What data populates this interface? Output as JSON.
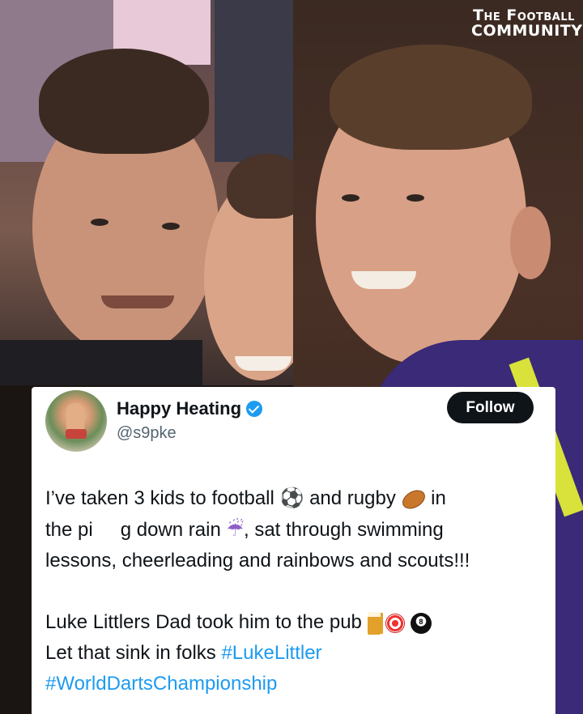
{
  "logo": {
    "line1": "The Football",
    "line2": "Community"
  },
  "tweet": {
    "display_name": "Happy Heating",
    "verified": true,
    "handle": "@s9pke",
    "follow_label": "Follow",
    "line1_a": "I’ve taken 3 kids to football",
    "line1_b": "and rugby",
    "line1_c": "in",
    "line2_a": "the pi",
    "line2_b": "g down rain",
    "line2_c": ", sat through swimming",
    "line3": "lessons, cheerleading and rainbows and scouts!!!",
    "line4": "Luke Littlers Dad took him to the pub",
    "line5": "Let that sink in folks",
    "hashtag1": "#LukeLittler",
    "hashtag2": "#WorldDartsChampionship",
    "eight_ball_number": "8"
  },
  "icons": [
    "soccer-ball-icon",
    "rugby-ball-icon",
    "umbrella-rain-icon",
    "beer-mug-icon",
    "dart-target-icon",
    "eight-ball-icon",
    "verified-badge-icon"
  ],
  "colors": {
    "link": "#1d9bf0",
    "verified": "#1d9bf0",
    "follow_bg": "#0f1419",
    "handle": "#536471"
  }
}
